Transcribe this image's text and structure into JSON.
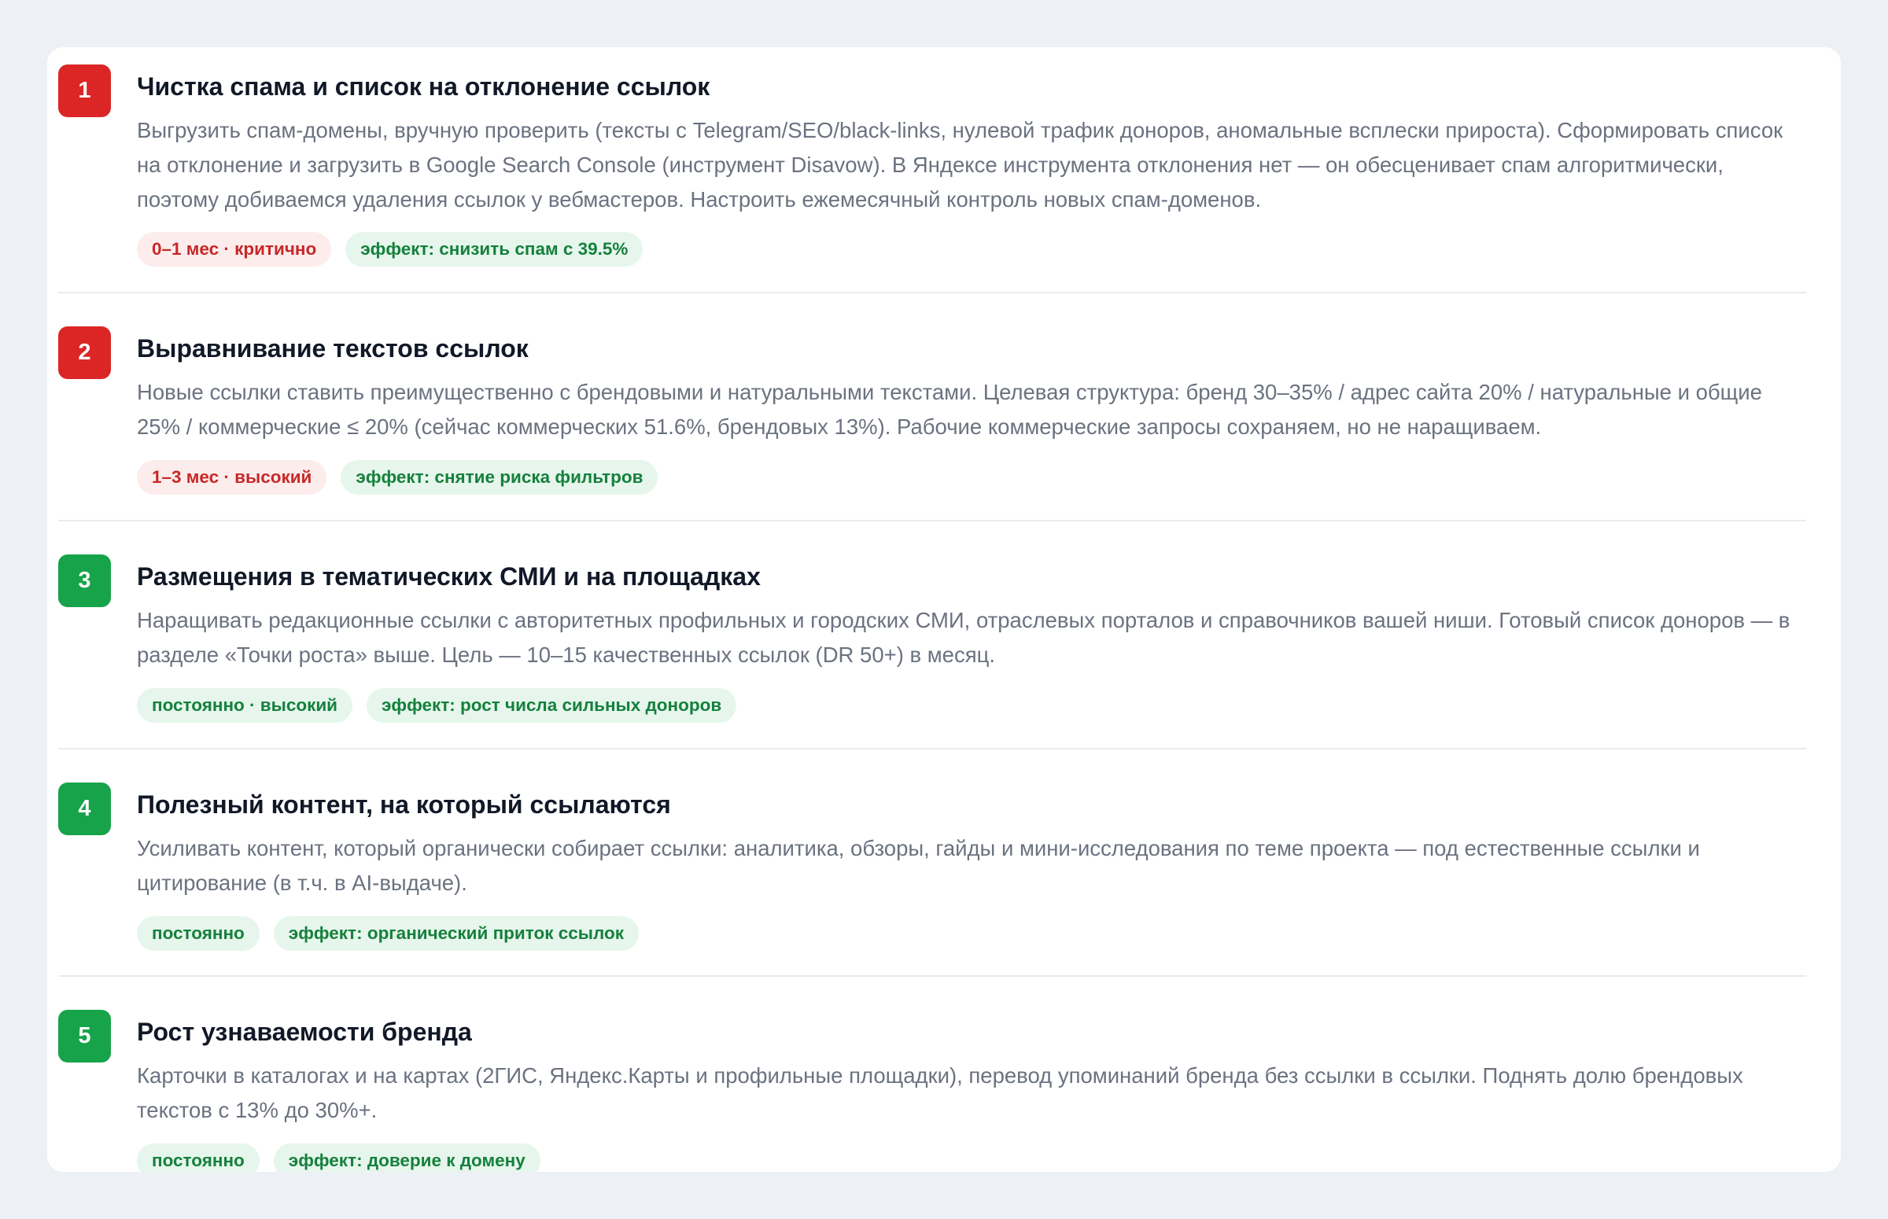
{
  "steps": [
    {
      "number": "1",
      "title": "Чистка спама и список на отклонение ссылок",
      "description": "Выгрузить спам-домены, вручную проверить (тексты с Telegram/SEO/black-links, нулевой трафик доноров, аномальные всплески прироста). Сформировать список на отклонение и загрузить в Google Search Console (инструмент Disavow). В Яндексе инструмента отклонения нет — он обесценивает спам алгоритмически, поэтому добиваемся удаления ссылок у вебмастеров. Настроить ежемесячный контроль новых спам-доменов.",
      "badge_color": "#dc2626",
      "tags": {
        "priority": "0–1 мес · критично",
        "effect": "эффект: снизить спам с 39.5%"
      }
    },
    {
      "number": "2",
      "title": "Выравнивание текстов ссылок",
      "description": "Новые ссылки ставить преимущественно с брендовыми и натуральными текстами. Целевая структура: бренд 30–35% / адрес сайта 20% / натуральные и общие 25% / коммерческие ≤ 20% (сейчас коммерческих 51.6%, брендовых 13%). Рабочие коммерческие запросы сохраняем, но не наращиваем.",
      "badge_color": "#dc2626",
      "tags": {
        "priority": "1–3 мес · высокий",
        "effect": "эффект: снятие риска фильтров"
      }
    },
    {
      "number": "3",
      "title": "Размещения в тематических СМИ и на площадках",
      "description": "Наращивать редакционные ссылки с авторитетных профильных и городских СМИ, отраслевых порталов и справочников вашей ниши. Готовый список доноров — в разделе «Точки роста» выше. Цель — 10–15 качественных ссылок (DR 50+) в месяц.",
      "badge_color": "#16a34a",
      "tags": {
        "priority": "постоянно · высокий",
        "effect": "эффект: рост числа сильных доноров"
      }
    },
    {
      "number": "4",
      "title": "Полезный контент, на который ссылаются",
      "description": "Усиливать контент, который органически собирает ссылки: аналитика, обзоры, гайды и мини-исследования по теме проекта — под естественные ссылки и цитирование (в т.ч. в AI-выдаче).",
      "badge_color": "#16a34a",
      "tags": {
        "priority": "постоянно",
        "effect": "эффект: органический приток ссылок"
      }
    },
    {
      "number": "5",
      "title": "Рост узнаваемости бренда",
      "description": "Карточки в каталогах и на картах (2ГИС, Яндекс.Карты и профильные площадки), перевод упоминаний бренда без ссылки в ссылки. Поднять долю брендовых текстов с 13% до 30%+.",
      "badge_color": "#16a34a",
      "tags": {
        "priority": "постоянно",
        "effect": "эффект: доверие к домену"
      }
    }
  ],
  "colors": {
    "page_background": "#edf0f4",
    "card_background": "#ffffff",
    "red_badge": "#dc2626",
    "green_badge": "#16a34a",
    "critical_tag_bg": "#fdecec",
    "critical_tag_text": "#c62828",
    "effect_tag_bg": "#e6f6ec",
    "effect_tag_text": "#15803d"
  }
}
